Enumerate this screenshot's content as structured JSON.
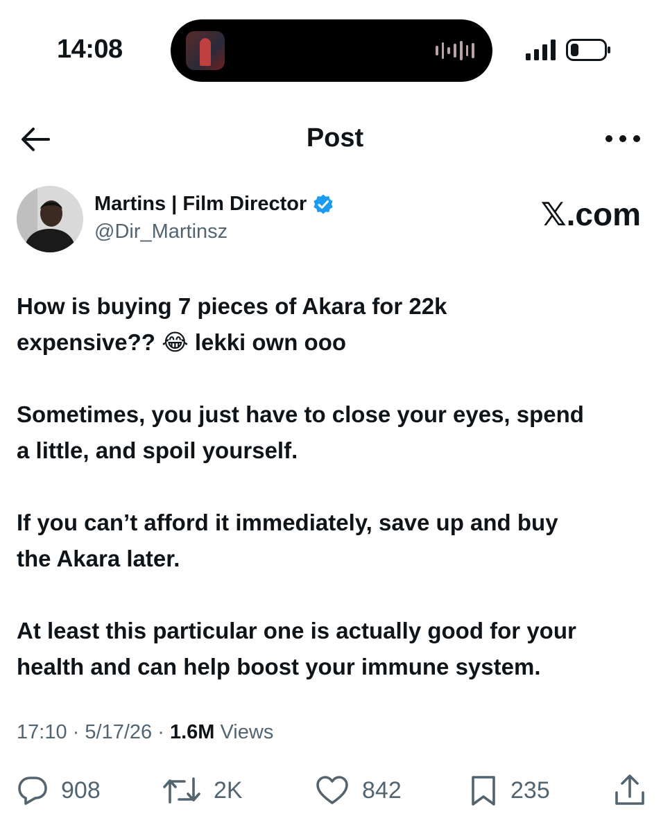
{
  "status_bar": {
    "time": "14:08"
  },
  "header": {
    "title": "Post"
  },
  "author": {
    "name": "Martins | Film Director",
    "handle": "@Dir_Martinsz"
  },
  "watermark": "𝕏.com",
  "tweet": {
    "paragraphs": [
      "How is buying 7 pieces of Akara for 22k\nexpensive?? 😂 lekki own ooo",
      "Sometimes, you just have to close your eyes, spend\na little, and spoil yourself.",
      "If you can’t afford it immediately, save up and buy\nthe Akara later.",
      "At least this particular one is actually good for your\nhealth and can help boost your immune system."
    ]
  },
  "meta": {
    "time": "17:10",
    "date": "5/17/26",
    "separator": "·",
    "views_count": "1.6M",
    "views_label": "Views"
  },
  "actions": {
    "replies": "908",
    "reposts": "2K",
    "likes": "842",
    "bookmarks": "235"
  },
  "icons": {
    "back": "back-arrow-icon",
    "more": "more-icon",
    "verified": "verified-badge-icon",
    "reply": "reply-icon",
    "repost": "repost-icon",
    "like": "heart-icon",
    "bookmark": "bookmark-icon",
    "share": "share-icon"
  },
  "colors": {
    "text": "#0f1419",
    "secondary": "#536471",
    "verified": "#1d9bf0"
  }
}
